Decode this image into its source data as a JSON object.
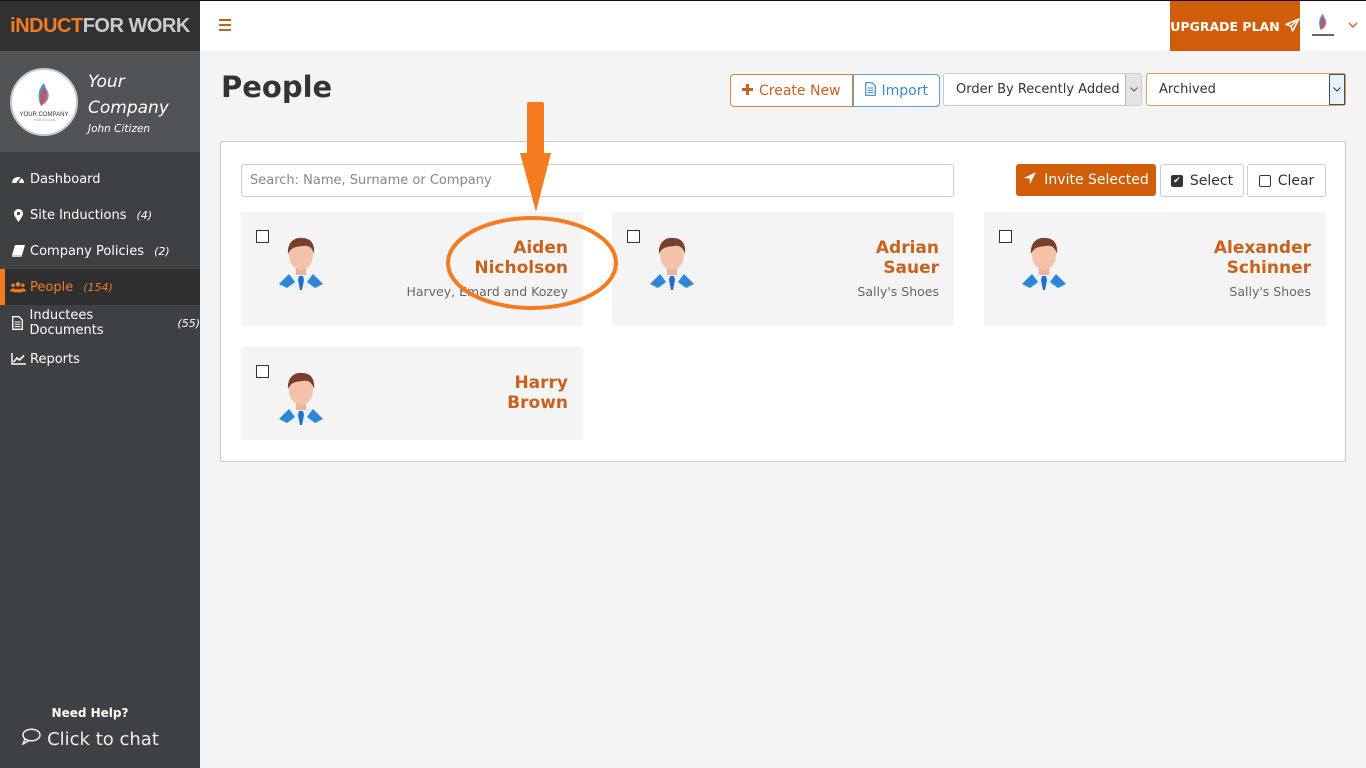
{
  "brand": {
    "part1": "iNDUCT",
    "part2": "FOR WORK"
  },
  "profile": {
    "company_line1": "Your",
    "company_line2": "Company",
    "user": "John Citizen",
    "logo_label": "YOUR COMPANY",
    "logo_slogan": "YOUR SLOGAN"
  },
  "sidebar": {
    "items": [
      {
        "label": "Dashboard",
        "count": "",
        "icon": "dashboard-icon"
      },
      {
        "label": "Site Inductions",
        "count": "(4)",
        "icon": "map-marker-icon"
      },
      {
        "label": "Company Policies",
        "count": "(2)",
        "icon": "book-icon"
      },
      {
        "label": "People",
        "count": "(154)",
        "icon": "users-icon",
        "active": true
      },
      {
        "label": "Inductees Documents",
        "count": "(55)",
        "icon": "document-icon"
      },
      {
        "label": "Reports",
        "count": "",
        "icon": "line-chart-icon"
      }
    ],
    "help_title": "Need Help?",
    "chat_label": "Click to chat"
  },
  "topbar": {
    "upgrade_label": "UPGRADE PLAN"
  },
  "page": {
    "title": "People",
    "create_label": "Create New",
    "import_label": "Import",
    "order_select": "Order By Recently Added",
    "status_select": "Archived"
  },
  "toolbar": {
    "search_placeholder": "Search: Name, Surname or Company",
    "search_value": "",
    "invite_label": "Invite Selected",
    "select_label": "Select",
    "clear_label": "Clear"
  },
  "people": [
    {
      "first": "Aiden",
      "last": "Nicholson",
      "company": "Harvey, Emard and Kozey",
      "checked": false
    },
    {
      "first": "Adrian",
      "last": "Sauer",
      "company": "Sally's Shoes",
      "checked": false
    },
    {
      "first": "Alexander",
      "last": "Schinner",
      "company": "Sally's Shoes",
      "checked": false
    },
    {
      "first": "Harry",
      "last": "Brown",
      "company": "",
      "checked": false
    }
  ],
  "colors": {
    "accent": "#f47b20",
    "button_orange": "#cf5d0a",
    "name_orange": "#c8621c",
    "sidebar_bg": "#3e4144",
    "annotation": "#f47b20"
  }
}
